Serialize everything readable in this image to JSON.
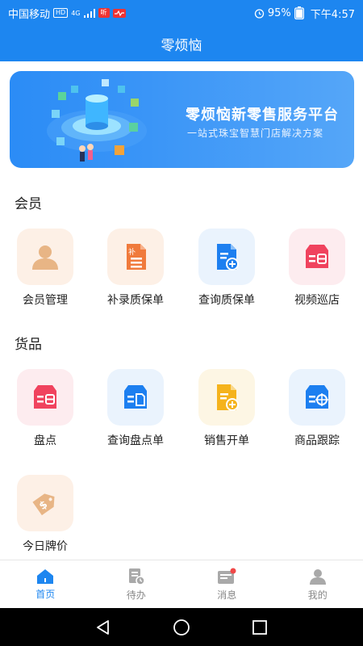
{
  "status_bar": {
    "carrier": "中国移动",
    "hd_badge": "HD",
    "net": "4G",
    "app_badge": "听",
    "battery": "95%",
    "time": "下午4:57"
  },
  "app": {
    "title": "零烦恼"
  },
  "banner": {
    "title": "零烦恼新零售服务平台",
    "subtitle": "一站式珠宝智慧门店解决方案"
  },
  "sections": [
    {
      "title": "会员",
      "items": [
        {
          "label": "会员管理",
          "icon": "member-icon",
          "tile_color": "#fdf0e6",
          "icon_color": "#e8b585"
        },
        {
          "label": "补录质保单",
          "icon": "supplement-warranty-icon",
          "tile_color": "#fdf0e6",
          "icon_color": "#f07a3c"
        },
        {
          "label": "查询质保单",
          "icon": "search-warranty-icon",
          "tile_color": "#eaf3fd",
          "icon_color": "#1d7ff0"
        },
        {
          "label": "视频巡店",
          "icon": "video-patrol-icon",
          "tile_color": "#fdecef",
          "icon_color": "#f0435e"
        }
      ]
    },
    {
      "title": "货品",
      "items": [
        {
          "label": "盘点",
          "icon": "inventory-icon",
          "tile_color": "#fdecef",
          "icon_color": "#f0435e"
        },
        {
          "label": "查询盘点单",
          "icon": "search-inventory-icon",
          "tile_color": "#eaf3fd",
          "icon_color": "#1d7ff0"
        },
        {
          "label": "销售开单",
          "icon": "sales-order-icon",
          "tile_color": "#fdf6e4",
          "icon_color": "#f5b31c"
        },
        {
          "label": "商品跟踪",
          "icon": "product-tracking-icon",
          "tile_color": "#eaf3fd",
          "icon_color": "#1d7ff0"
        },
        {
          "label": "今日牌价",
          "icon": "price-tag-icon",
          "tile_color": "#fdf0e6",
          "icon_color": "#e8b585"
        }
      ]
    }
  ],
  "tabs": [
    {
      "label": "首页",
      "icon": "home-icon",
      "active": true
    },
    {
      "label": "待办",
      "icon": "todo-icon",
      "active": false
    },
    {
      "label": "消息",
      "icon": "message-icon",
      "active": false,
      "dot": true
    },
    {
      "label": "我的",
      "icon": "profile-icon",
      "active": false
    }
  ],
  "colors": {
    "primary": "#1d86f0",
    "tab_active": "#1d86f0",
    "tab_inactive": "#888888",
    "unread_dot": "#f04848"
  }
}
